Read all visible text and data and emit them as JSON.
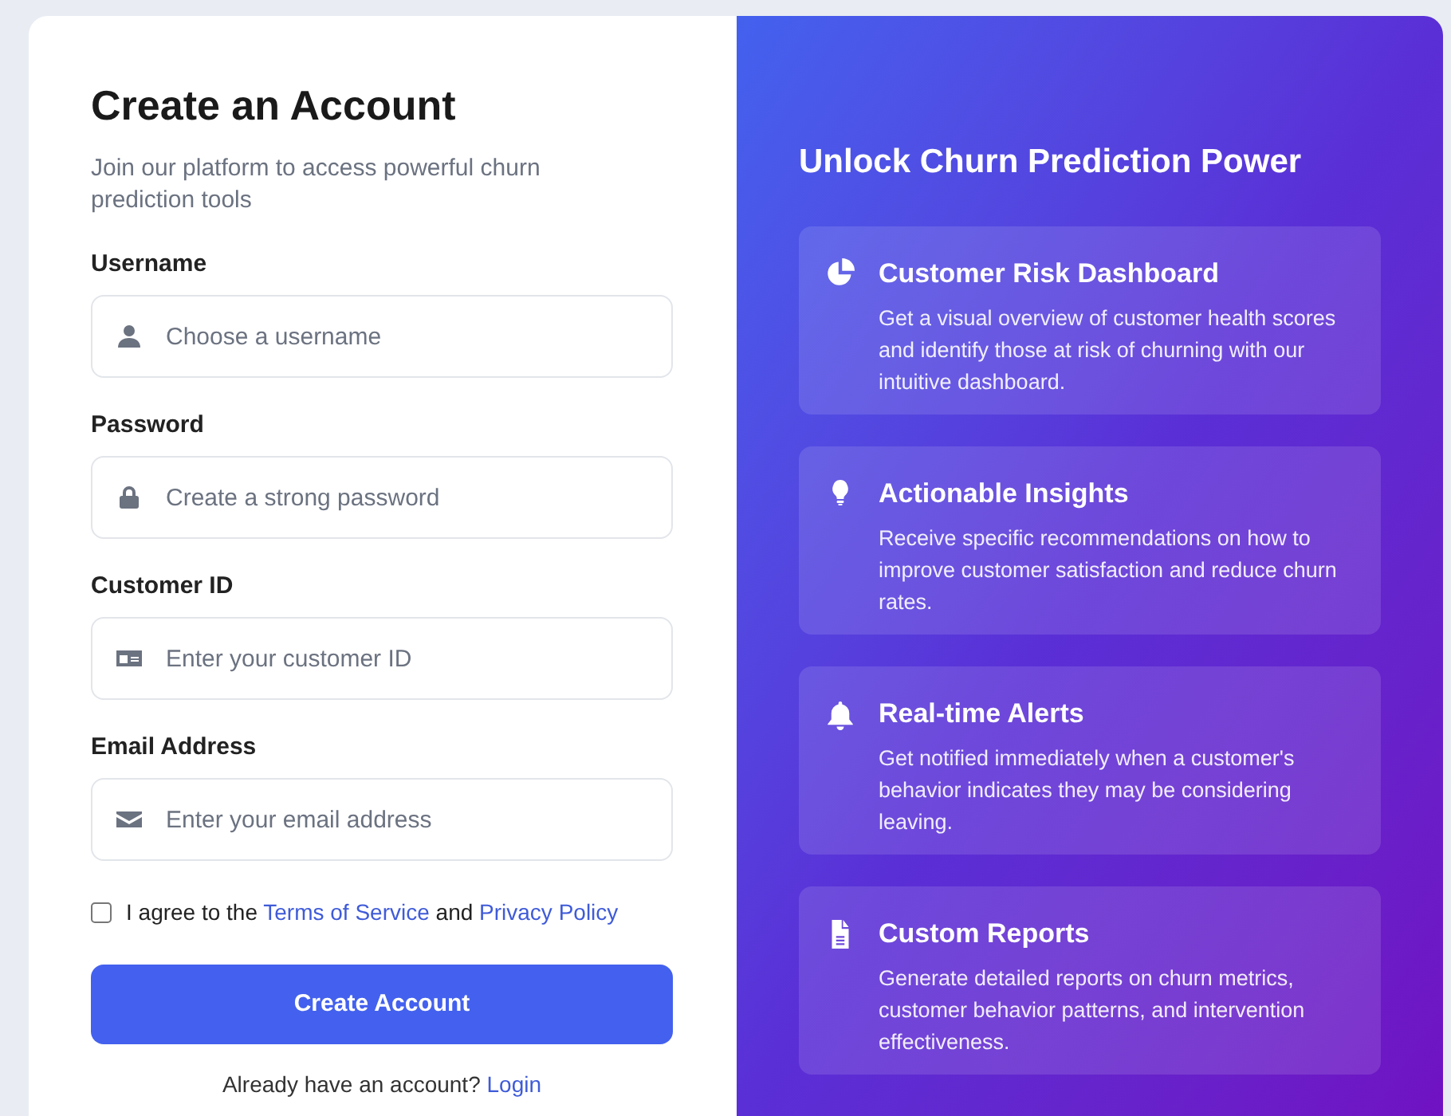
{
  "signup": {
    "title": "Create an Account",
    "subtitle": "Join our platform to access powerful churn prediction tools",
    "fields": [
      {
        "label": "Username",
        "placeholder": "Choose a username",
        "kind": "user"
      },
      {
        "label": "Password",
        "placeholder": "Create a strong password",
        "kind": "lock"
      },
      {
        "label": "Customer ID",
        "placeholder": "Enter your customer ID",
        "kind": "card"
      },
      {
        "label": "Email Address",
        "placeholder": "Enter your email address",
        "kind": "mail"
      }
    ],
    "agreement": {
      "checked": false,
      "text_1": "I agree to the",
      "link_1": "Terms of Service",
      "text_2": "and",
      "link_2": "Privacy Policy"
    },
    "submit_button": "Create Account",
    "login_prompt": {
      "text": "Already have an account?",
      "link": "Login"
    }
  },
  "promo": {
    "title": "Unlock Churn Prediction Power",
    "features": [
      {
        "kind": "pie",
        "title": "Customer Risk Dashboard",
        "description": "Get a visual overview of customer health scores and identify those at risk of churning with our intuitive dashboard."
      },
      {
        "kind": "bulb",
        "title": "Actionable Insights",
        "description": "Receive specific recommendations on how to improve customer satisfaction and reduce churn rates."
      },
      {
        "kind": "bell",
        "title": "Real-time Alerts",
        "description": "Get notified immediately when a customer's behavior indicates they may be considering leaving."
      },
      {
        "kind": "file",
        "title": "Custom Reports",
        "description": "Generate detailed reports on churn metrics, customer behavior patterns, and intervention effectiveness."
      }
    ]
  }
}
